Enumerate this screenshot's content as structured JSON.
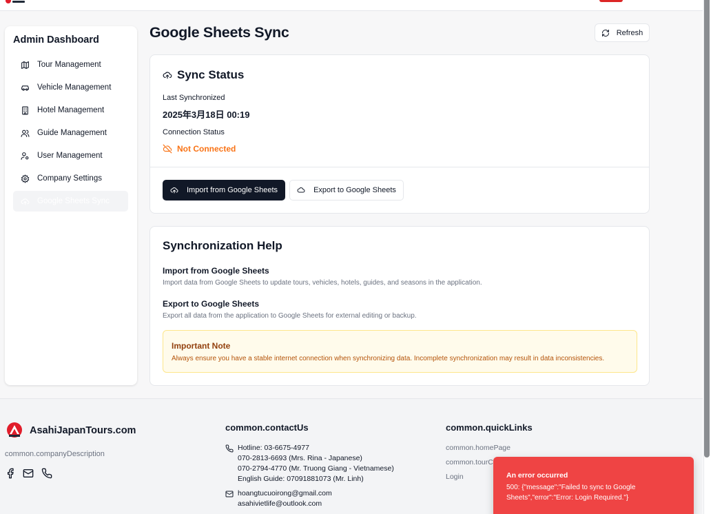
{
  "header": {
    "logo_alt": "AsahiJapanTours.com"
  },
  "sidebar": {
    "title": "Admin Dashboard",
    "items": [
      {
        "label": "Tour Management",
        "icon": "map-icon"
      },
      {
        "label": "Vehicle Management",
        "icon": "car-icon"
      },
      {
        "label": "Hotel Management",
        "icon": "building-icon"
      },
      {
        "label": "Guide Management",
        "icon": "users-icon"
      },
      {
        "label": "User Management",
        "icon": "user-cog-icon"
      },
      {
        "label": "Company Settings",
        "icon": "gear-icon"
      },
      {
        "label": "Google Sheets Sync",
        "icon": "cloud-sync-icon",
        "active": true
      }
    ]
  },
  "main": {
    "title": "Google Sheets Sync",
    "refresh_label": "Refresh",
    "sync_status": {
      "title": "Sync Status",
      "last_sync_label": "Last Synchronized",
      "last_sync_value": "2025年3月18日 00:19",
      "connection_label": "Connection Status",
      "connection_value": "Not Connected",
      "import_label": "Import from Google Sheets",
      "export_label": "Export to Google Sheets"
    },
    "help": {
      "title": "Synchronization Help",
      "import_title": "Import from Google Sheets",
      "import_desc": "Import data from Google Sheets to update tours, vehicles, hotels, guides, and seasons in the application.",
      "export_title": "Export to Google Sheets",
      "export_desc": "Export all data from the application to Google Sheets for external editing or backup.",
      "note_title": "Important Note",
      "note_desc": "Always ensure you have a stable internet connection when synchronizing data. Incomplete synchronization may result in data inconsistencies."
    }
  },
  "footer": {
    "brand": "AsahiJapanTours.com",
    "company_description": "common.companyDescription",
    "contact_heading": "common.contactUs",
    "hotline_lines": [
      "Hotline: 03-6675-4977",
      "070-2813-6693 (Mrs. Rina - Japanese)",
      "070-2794-4770 (Mr. Truong Giang - Vietnamese)",
      "English Guide: 07091881073 (Mr. Linh)"
    ],
    "emails": [
      "hoangtucuoirong@gmail.com",
      "asahivietlife@outlook.com"
    ],
    "quicklinks_heading": "common.quickLinks",
    "quicklinks": [
      "common.homePage",
      "common.tourC",
      "Login"
    ]
  },
  "toast": {
    "title": "An error occurred",
    "message": "500: {\"message\":\"Failed to sync to Google Sheets\",\"error\":\"Error: Login Required.\"}"
  },
  "colors": {
    "primary_dark": "#111827",
    "warning_orange": "#f97316",
    "error_red": "#ef4444",
    "note_bg": "#fffbeb",
    "note_text": "#b45309"
  }
}
